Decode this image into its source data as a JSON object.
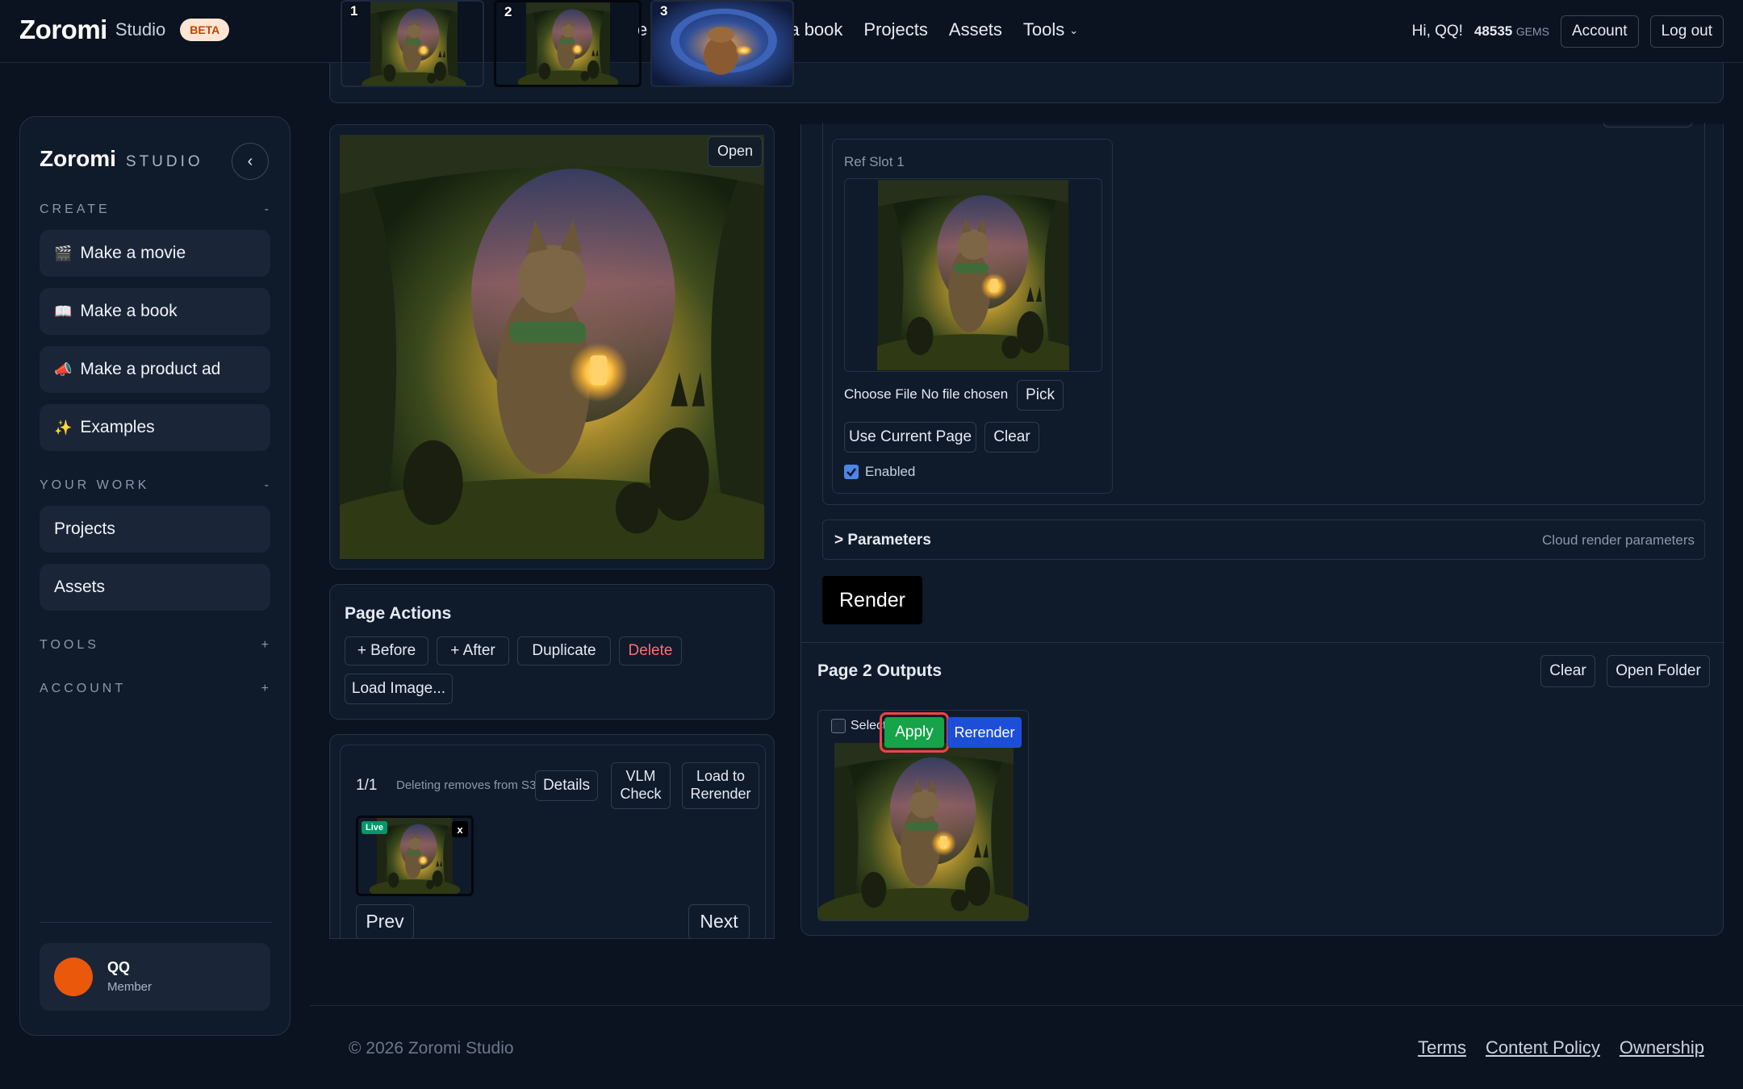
{
  "header": {
    "logo": "Zoromi",
    "logo_sub": "Studio",
    "beta": "BETA",
    "nav": [
      "e a book",
      "Projects",
      "Assets",
      "Tools"
    ],
    "greeting": "Hi, QQ!",
    "gems_value": "48535",
    "gems_label": "GEMS",
    "account": "Account",
    "logout": "Log out",
    "thumbs": [
      "1",
      "2",
      "3"
    ],
    "partial_nav": "e"
  },
  "sidebar": {
    "brand": "Zoromi",
    "brand_sub": "STUDIO",
    "create_label": "CREATE",
    "create_toggle": "-",
    "create_items": [
      {
        "emoji": "🎬",
        "label": "Make a movie"
      },
      {
        "emoji": "📖",
        "label": "Make a book"
      },
      {
        "emoji": "📣",
        "label": "Make a product ad"
      },
      {
        "emoji": "✨",
        "label": "Examples"
      }
    ],
    "work_label": "YOUR WORK",
    "work_toggle": "-",
    "work_items": [
      "Projects",
      "Assets"
    ],
    "tools_label": "TOOLS",
    "tools_toggle": "+",
    "account_label": "ACCOUNT",
    "account_toggle": "+",
    "user_name": "QQ",
    "user_role": "Member"
  },
  "preview": {
    "open": "Open"
  },
  "page_actions": {
    "title": "Page Actions",
    "before": "+ Before",
    "after": "+ After",
    "duplicate": "Duplicate",
    "delete": "Delete",
    "load_image": "Load Image..."
  },
  "versions": {
    "counter": "1/1",
    "note": "Deleting removes from S3",
    "details": "Details",
    "vlm_check": "VLM Check",
    "load_to_rerender": "Load to Rerender",
    "live": "Live",
    "remove": "x",
    "prev": "Prev",
    "next": "Next"
  },
  "ref_slot": {
    "title": "Ref Slot 1",
    "choose_file": "Choose File",
    "no_file": "No file chosen",
    "pick": "Pick",
    "use_current": "Use Current Page",
    "clear": "Clear",
    "enabled": "Enabled",
    "enabled_checked": true
  },
  "parameters": {
    "label": "> Parameters",
    "hint": "Cloud render parameters"
  },
  "render": {
    "label": "Render"
  },
  "outputs": {
    "title": "Page 2 Outputs",
    "clear": "Clear",
    "open_folder": "Open Folder",
    "select": "Select",
    "apply": "Apply",
    "rerender": "Rerender"
  },
  "footer": {
    "copyright": "© 2026 Zoromi Studio",
    "links": [
      "Terms",
      "Content Policy",
      "Ownership"
    ]
  },
  "colors": {
    "background": "#0b1220",
    "panel": "#0f1a2b",
    "apply_green": "#16a34a",
    "rerender_blue": "#1d4ed8",
    "delete_red": "#f87171",
    "live_green": "#059669",
    "avatar_orange": "#ea580c",
    "beta_bg": "#ffe6d2"
  }
}
